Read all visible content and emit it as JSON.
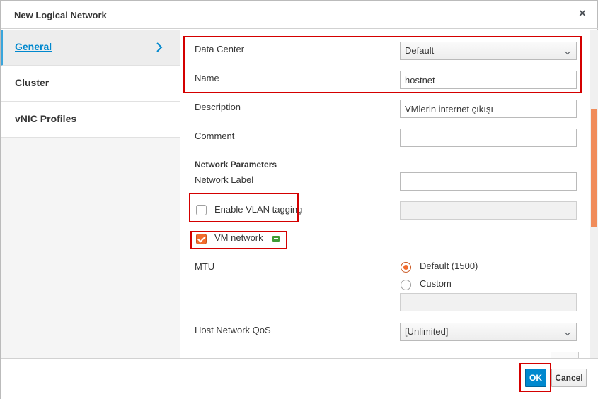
{
  "dialog": {
    "title": "New Logical Network",
    "close_symbol": "×"
  },
  "sidebar": {
    "items": [
      {
        "label": "General",
        "active": true
      },
      {
        "label": "Cluster",
        "active": false
      },
      {
        "label": "vNIC Profiles",
        "active": false
      }
    ]
  },
  "form": {
    "data_center": {
      "label": "Data Center",
      "value": "Default"
    },
    "name": {
      "label": "Name",
      "value": "hostnet"
    },
    "description": {
      "label": "Description",
      "value": "VMlerin internet çıkışı"
    },
    "comment": {
      "label": "Comment",
      "value": ""
    },
    "network_parameters": {
      "heading": "Network Parameters",
      "network_label": {
        "label": "Network Label",
        "value": ""
      },
      "enable_vlan_tagging": {
        "label": "Enable VLAN tagging",
        "checked": false,
        "value": ""
      },
      "vm_network": {
        "label": "VM network",
        "checked": true
      },
      "mtu": {
        "label": "MTU",
        "options": [
          {
            "label": "Default (1500)",
            "selected": true
          },
          {
            "label": "Custom",
            "selected": false
          }
        ],
        "custom_value": ""
      },
      "host_network_qos": {
        "label": "Host Network QoS",
        "value": "[Unlimited]"
      }
    }
  },
  "footer": {
    "ok_label": "OK",
    "cancel_label": "Cancel"
  },
  "colors": {
    "accent": "#0088ce",
    "checked": "#f26b2d",
    "highlight": "#d40000",
    "vm_icon": "#3f9c35"
  },
  "icons": {
    "close": "close-icon",
    "chevron": "chevron-right-icon",
    "vm": "vm-icon"
  }
}
